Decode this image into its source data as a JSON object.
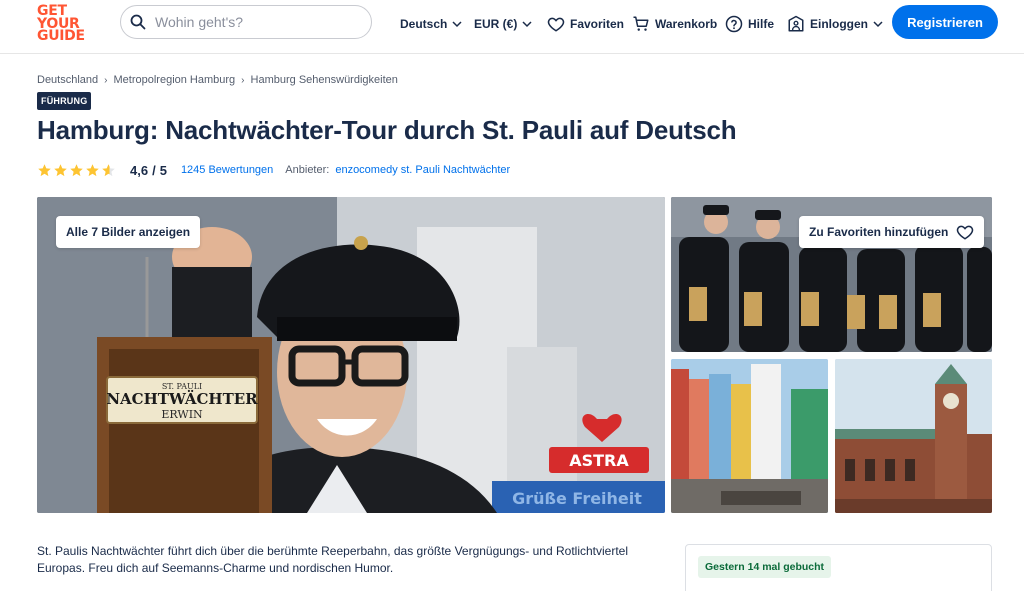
{
  "header": {
    "logo_lines": [
      "GET",
      "YOUR",
      "GUIDE"
    ],
    "search_placeholder": "Wohin geht's?",
    "language": "Deutsch",
    "currency": "EUR (€)",
    "favorites": "Favoriten",
    "cart": "Warenkorb",
    "help": "Hilfe",
    "login": "Einloggen",
    "register": "Registrieren"
  },
  "breadcrumb": [
    "Deutschland",
    "Metropolregion Hamburg",
    "Hamburg Sehenswürdigkeiten"
  ],
  "activity": {
    "badge": "FÜHRUNG",
    "title": "Hamburg: Nachtwächter-Tour durch St. Pauli auf Deutsch",
    "rating": "4,6",
    "rating_max": "5",
    "rating_value": 4.6,
    "reviews": "1245 Bewertungen",
    "provider_label": "Anbieter:",
    "provider": "enzocomedy st. Pauli Nachtwächter"
  },
  "gallery": {
    "show_all": "Alle 7 Bilder anzeigen",
    "add_favorite": "Zu Favoriten hinzufügen",
    "sign_line1": "ST. PAULI",
    "sign_line2": "NACHTWÄCHTER",
    "sign_line3": "ERWIN",
    "bg_sign_1": "ASTRA",
    "bg_sign_2": "Grüße Freiheit"
  },
  "description": "St. Paulis Nachtwächter führt dich über die berühmte Reeperbahn, das größte Vergnügungs- und Rotlichtviertel Europas. Freu dich auf Seemanns-Charme und nordischen Humor.",
  "booking": {
    "booked_badge": "Gestern 14 mal gebucht"
  },
  "colors": {
    "brand": "#ff5533",
    "primary_blue": "#0071eb",
    "navy": "#1a2b49",
    "star": "#fdc432",
    "booked_green": "#0b6b3a"
  }
}
